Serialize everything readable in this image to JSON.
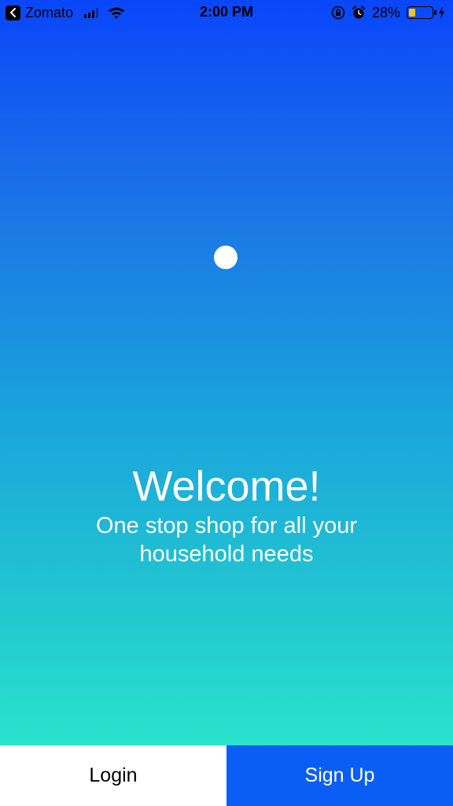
{
  "status_bar": {
    "back_app": "Zomato",
    "time": "2:00 PM",
    "battery_percent": "28%",
    "battery_level": 0.28,
    "icons": [
      "back-arrow-icon",
      "signal-icon",
      "wifi-icon",
      "orientation-lock-icon",
      "alarm-icon",
      "battery-icon",
      "charging-bolt-icon"
    ]
  },
  "welcome": {
    "title": "Welcome!",
    "subtitle": "One stop shop for all your household needs"
  },
  "actions": {
    "login_label": "Login",
    "signup_label": "Sign Up"
  },
  "colors": {
    "gradient_top": "#0a46fb",
    "gradient_bottom": "#2cefca",
    "signup_bg": "#0b5ef5",
    "login_bg": "#ffffff"
  }
}
